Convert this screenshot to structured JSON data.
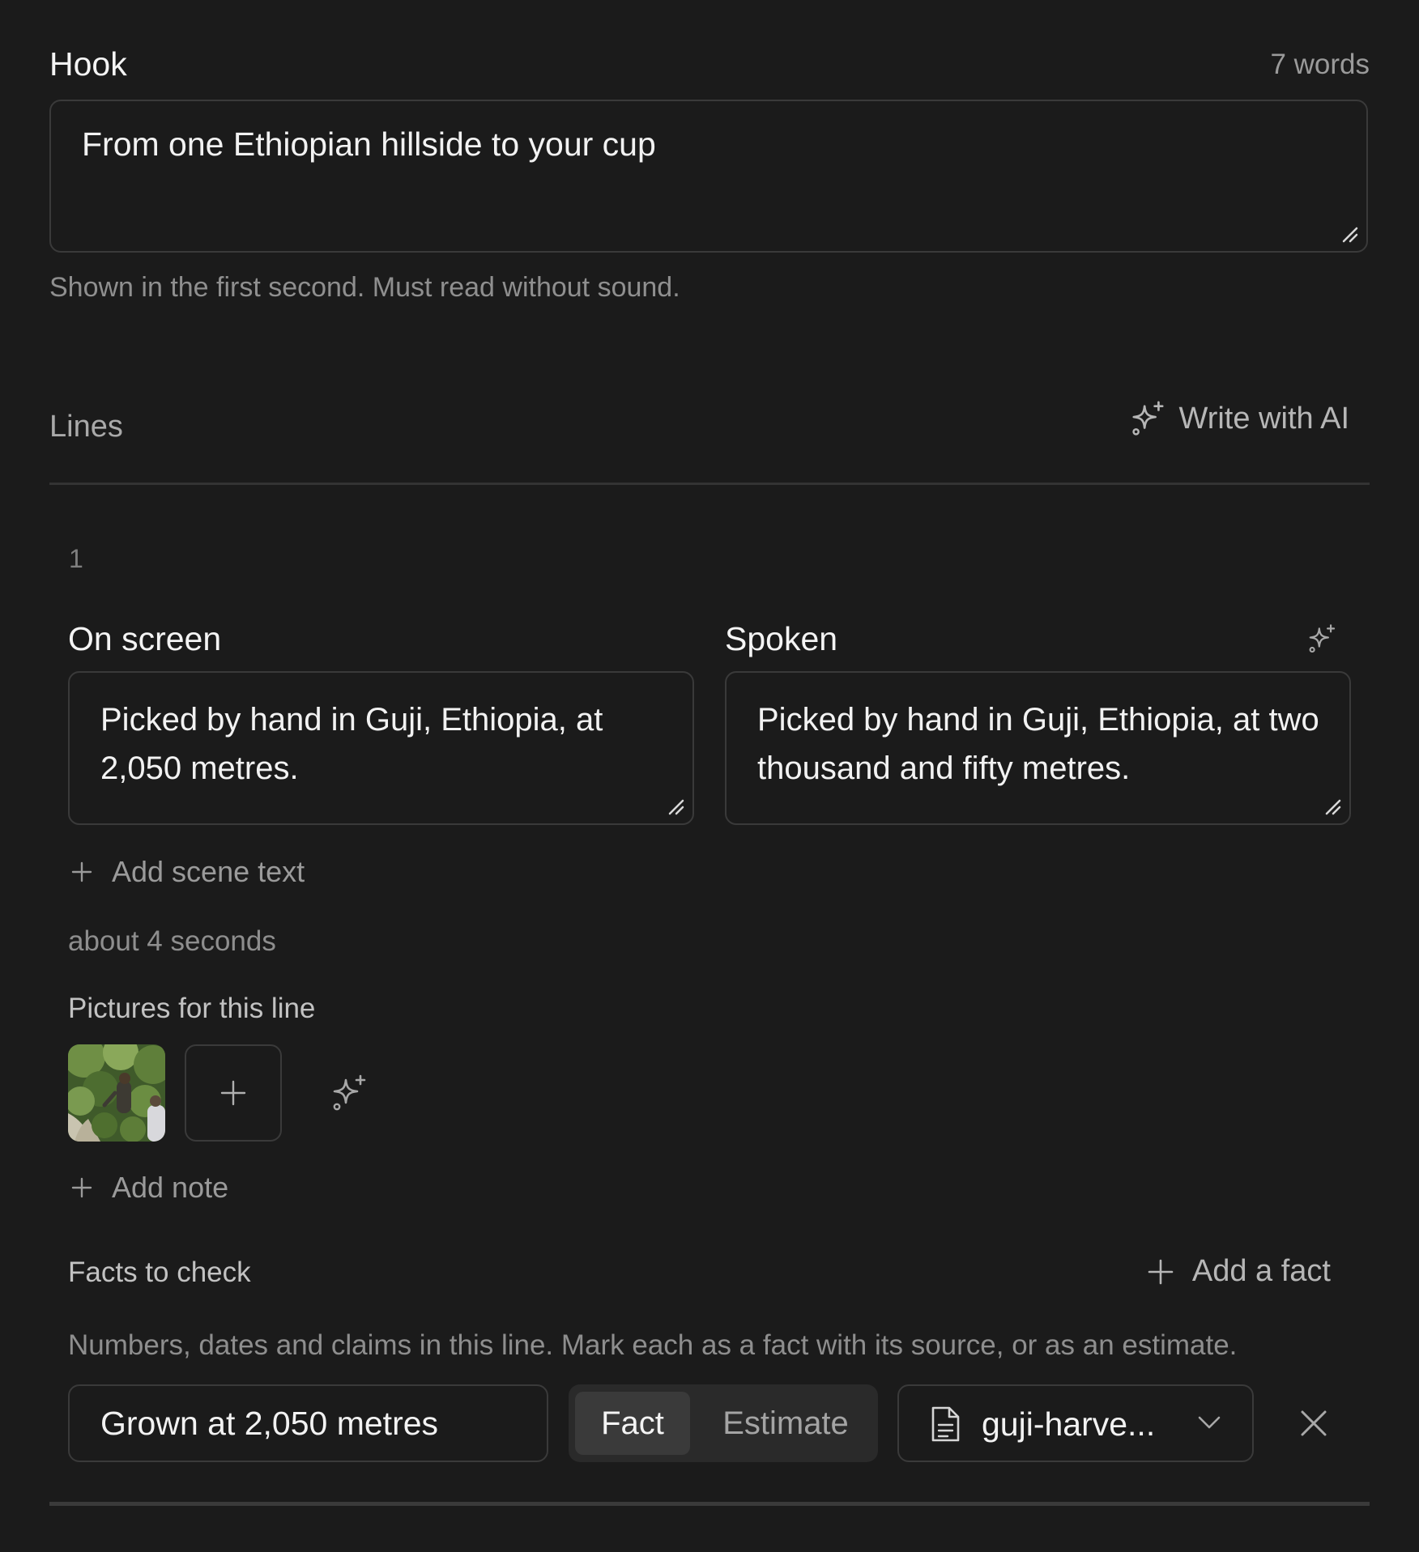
{
  "hook": {
    "label": "Hook",
    "word_count": "7 words",
    "value": "From one Ethiopian hillside to your cup",
    "hint": "Shown in the first second. Must read without sound."
  },
  "lines": {
    "label": "Lines",
    "write_ai_label": "Write with AI",
    "items": [
      {
        "number": "1",
        "on_screen_label": "On screen",
        "on_screen_text": "Picked by hand in Guji, Ethiopia, at 2,050 metres.",
        "spoken_label": "Spoken",
        "spoken_text": "Picked by hand in Guji, Ethiopia, at two thousand and fifty metres.",
        "add_scene_text": "Add scene text",
        "duration": "about 4 seconds",
        "pictures_label": "Pictures for this line",
        "add_note": "Add note",
        "facts": {
          "title": "Facts to check",
          "add_label": "Add a fact",
          "description": "Numbers, dates and claims in this line. Mark each as a fact with its source, or as an estimate.",
          "items": [
            {
              "claim": "Grown at 2,050 metres",
              "type_options": [
                "Fact",
                "Estimate"
              ],
              "selected_type": "Fact",
              "source": "guji-harve..."
            }
          ]
        }
      }
    ]
  },
  "colors": {
    "background": "#1b1b1b",
    "border": "#3a3a3a",
    "text": "#f2f2f2",
    "muted": "#8f8f8f"
  }
}
